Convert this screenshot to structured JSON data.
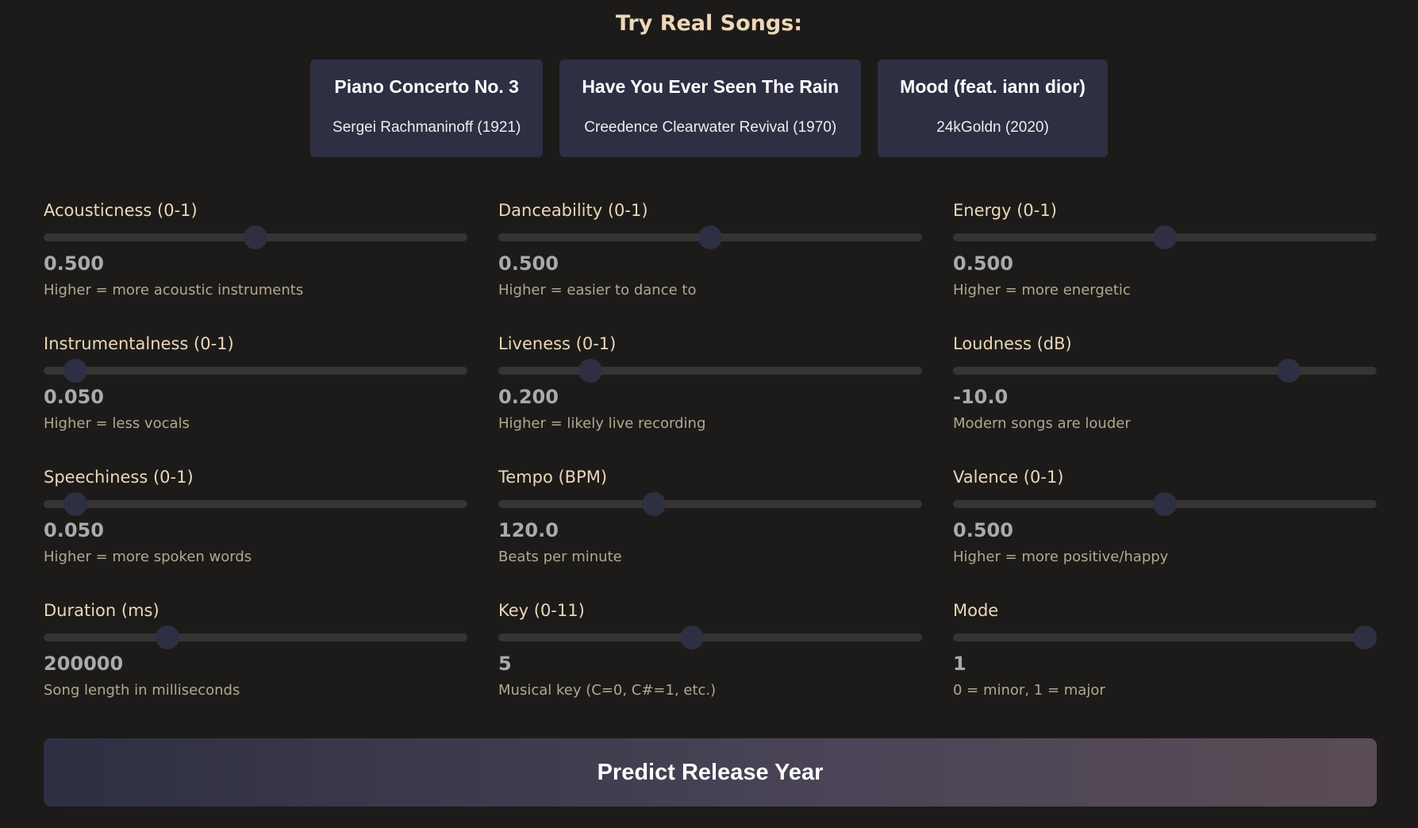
{
  "title": "Try Real Songs:",
  "songs": [
    {
      "title": "Piano Concerto No. 3",
      "artist": "Sergei Rachmaninoff (1921)"
    },
    {
      "title": "Have You Ever Seen The Rain",
      "artist": "Creedence Clearwater Revival (1970)"
    },
    {
      "title": "Mood (feat. iann dior)",
      "artist": "24kGoldn (2020)"
    }
  ],
  "features": [
    {
      "label": "Acousticness (0-1)",
      "value": "0.500",
      "hint": "Higher = more acoustic instruments",
      "level": 0.5
    },
    {
      "label": "Danceability (0-1)",
      "value": "0.500",
      "hint": "Higher = easier to dance to",
      "level": 0.5
    },
    {
      "label": "Energy (0-1)",
      "value": "0.500",
      "hint": "Higher = more energetic",
      "level": 0.5
    },
    {
      "label": "Instrumentalness (0-1)",
      "value": "0.050",
      "hint": "Higher = less vocals",
      "level": 0.05
    },
    {
      "label": "Liveness (0-1)",
      "value": "0.200",
      "hint": "Higher = likely live recording",
      "level": 0.2
    },
    {
      "label": "Loudness (dB)",
      "value": "-10.0",
      "hint": "Modern songs are louder",
      "level": 0.81
    },
    {
      "label": "Speechiness (0-1)",
      "value": "0.050",
      "hint": "Higher = more spoken words",
      "level": 0.05
    },
    {
      "label": "Tempo (BPM)",
      "value": "120.0",
      "hint": "Beats per minute",
      "level": 0.36
    },
    {
      "label": "Valence (0-1)",
      "value": "0.500",
      "hint": "Higher = more positive/happy",
      "level": 0.5
    },
    {
      "label": "Duration (ms)",
      "value": "200000",
      "hint": "Song length in milliseconds",
      "level": 0.28
    },
    {
      "label": "Key (0-11)",
      "value": "5",
      "hint": "Musical key (C=0, C#=1, etc.)",
      "level": 0.455
    },
    {
      "label": "Mode",
      "value": "1",
      "hint": "0 = minor, 1 = major",
      "level": 1.0
    }
  ],
  "predict_label": "Predict Release Year",
  "colors": {
    "background": "#1c1b19",
    "card": "#2e2f42",
    "label": "#ecd7b9",
    "hint": "#b3a790",
    "track": "#363534"
  }
}
